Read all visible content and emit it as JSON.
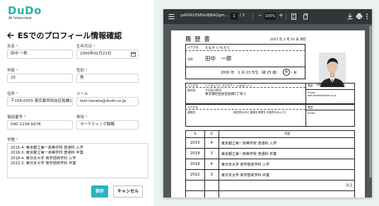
{
  "brand": {
    "logo": "DuDo",
    "subtitle": "AI Interview"
  },
  "page_title": "ESでのプロフィール情報確認",
  "form": {
    "name": {
      "label": "氏名",
      "value": "田中 一郎"
    },
    "birthdate": {
      "label": "生年月日",
      "value": "2000年01月23日"
    },
    "age": {
      "label": "年齢",
      "value": "25"
    },
    "gender": {
      "label": "性別",
      "value": "男"
    },
    "address": {
      "label": "住所",
      "value": "〒156-0055 東京都世田谷区船橋1丁"
    },
    "email": {
      "label": "メール",
      "value": "test.tanaka@dudo.co.jp"
    },
    "phone": {
      "label": "電話番号",
      "value": "090-1234-5678"
    },
    "major": {
      "label": "専攻",
      "value": "マーケティング戦略"
    },
    "education": {
      "label": "学歴",
      "lines": [
        "2015-4: 東京都立第一高等学校 普通科 入学",
        "2018-3: 東京都立第一高等学校 普通科 卒業",
        "2018-4: 東日本大学 商学部商学科 入学",
        "2022-3: 東日本大学 商学部商学科 卒業"
      ]
    },
    "required_mark": "*"
  },
  "buttons": {
    "save": "保存",
    "cancel": "キャンセル"
  },
  "viewer": {
    "filename": "yzKGPz3S8VuBJKA2gm...",
    "page_current": "1",
    "page_total": "/ 2",
    "zoom": "100%",
    "zoom_minus": "−",
    "zoom_plus": "+"
  },
  "resume": {
    "title": "履 歴 書",
    "date": "2025 年 2 月 20 日 現在",
    "furigana_label": "ふりがな",
    "furigana_name": "たなか いちろう",
    "name_label": "名前",
    "name": "田中　一郎",
    "birth": "2000 年　1 月 23 日生（満 25 歳）",
    "gender_male": "男",
    "gender_sep": "・女",
    "addr_furigana_label": "ふりがな",
    "addr_furigana": "とうきょうと せたがやく ふなばし1-1",
    "addr_label": "現住所",
    "postal": "〒156-0055",
    "address": "東京都世田谷区船橋1丁目-1",
    "phone_label": "電話",
    "phone": "090-1234-5678",
    "email_label": "Email",
    "email": "test.tanaka@dudo.co.jp",
    "contact_furigana_label": "ふりがな",
    "contact_label": "連絡先",
    "contact_note": "（現住所以外に連絡を希望する場合のみ入力）",
    "contact_phone_label": "電話",
    "contact_email_label": "Email",
    "table_headers": {
      "year": "年",
      "month": "月",
      "history": "学歴"
    },
    "rows": [
      {
        "year": "2015",
        "month": "4",
        "text": "東京都立第一高等学校 普通科 入学"
      },
      {
        "year": "2018",
        "month": "3",
        "text": "東京都立第一高等学校 普通科 卒業"
      },
      {
        "year": "2018",
        "month": "4",
        "text": "東日本大学 商学部商学科 入学"
      },
      {
        "year": "2022",
        "month": "3",
        "text": "東日本大学 商学部商学科 卒業"
      }
    ],
    "end_mark": "以上"
  },
  "colors": {
    "accent": "#2ab3c0",
    "brand": "#2ab3a8",
    "right_bg": "#e9f2ef",
    "toolbar": "#323639"
  }
}
